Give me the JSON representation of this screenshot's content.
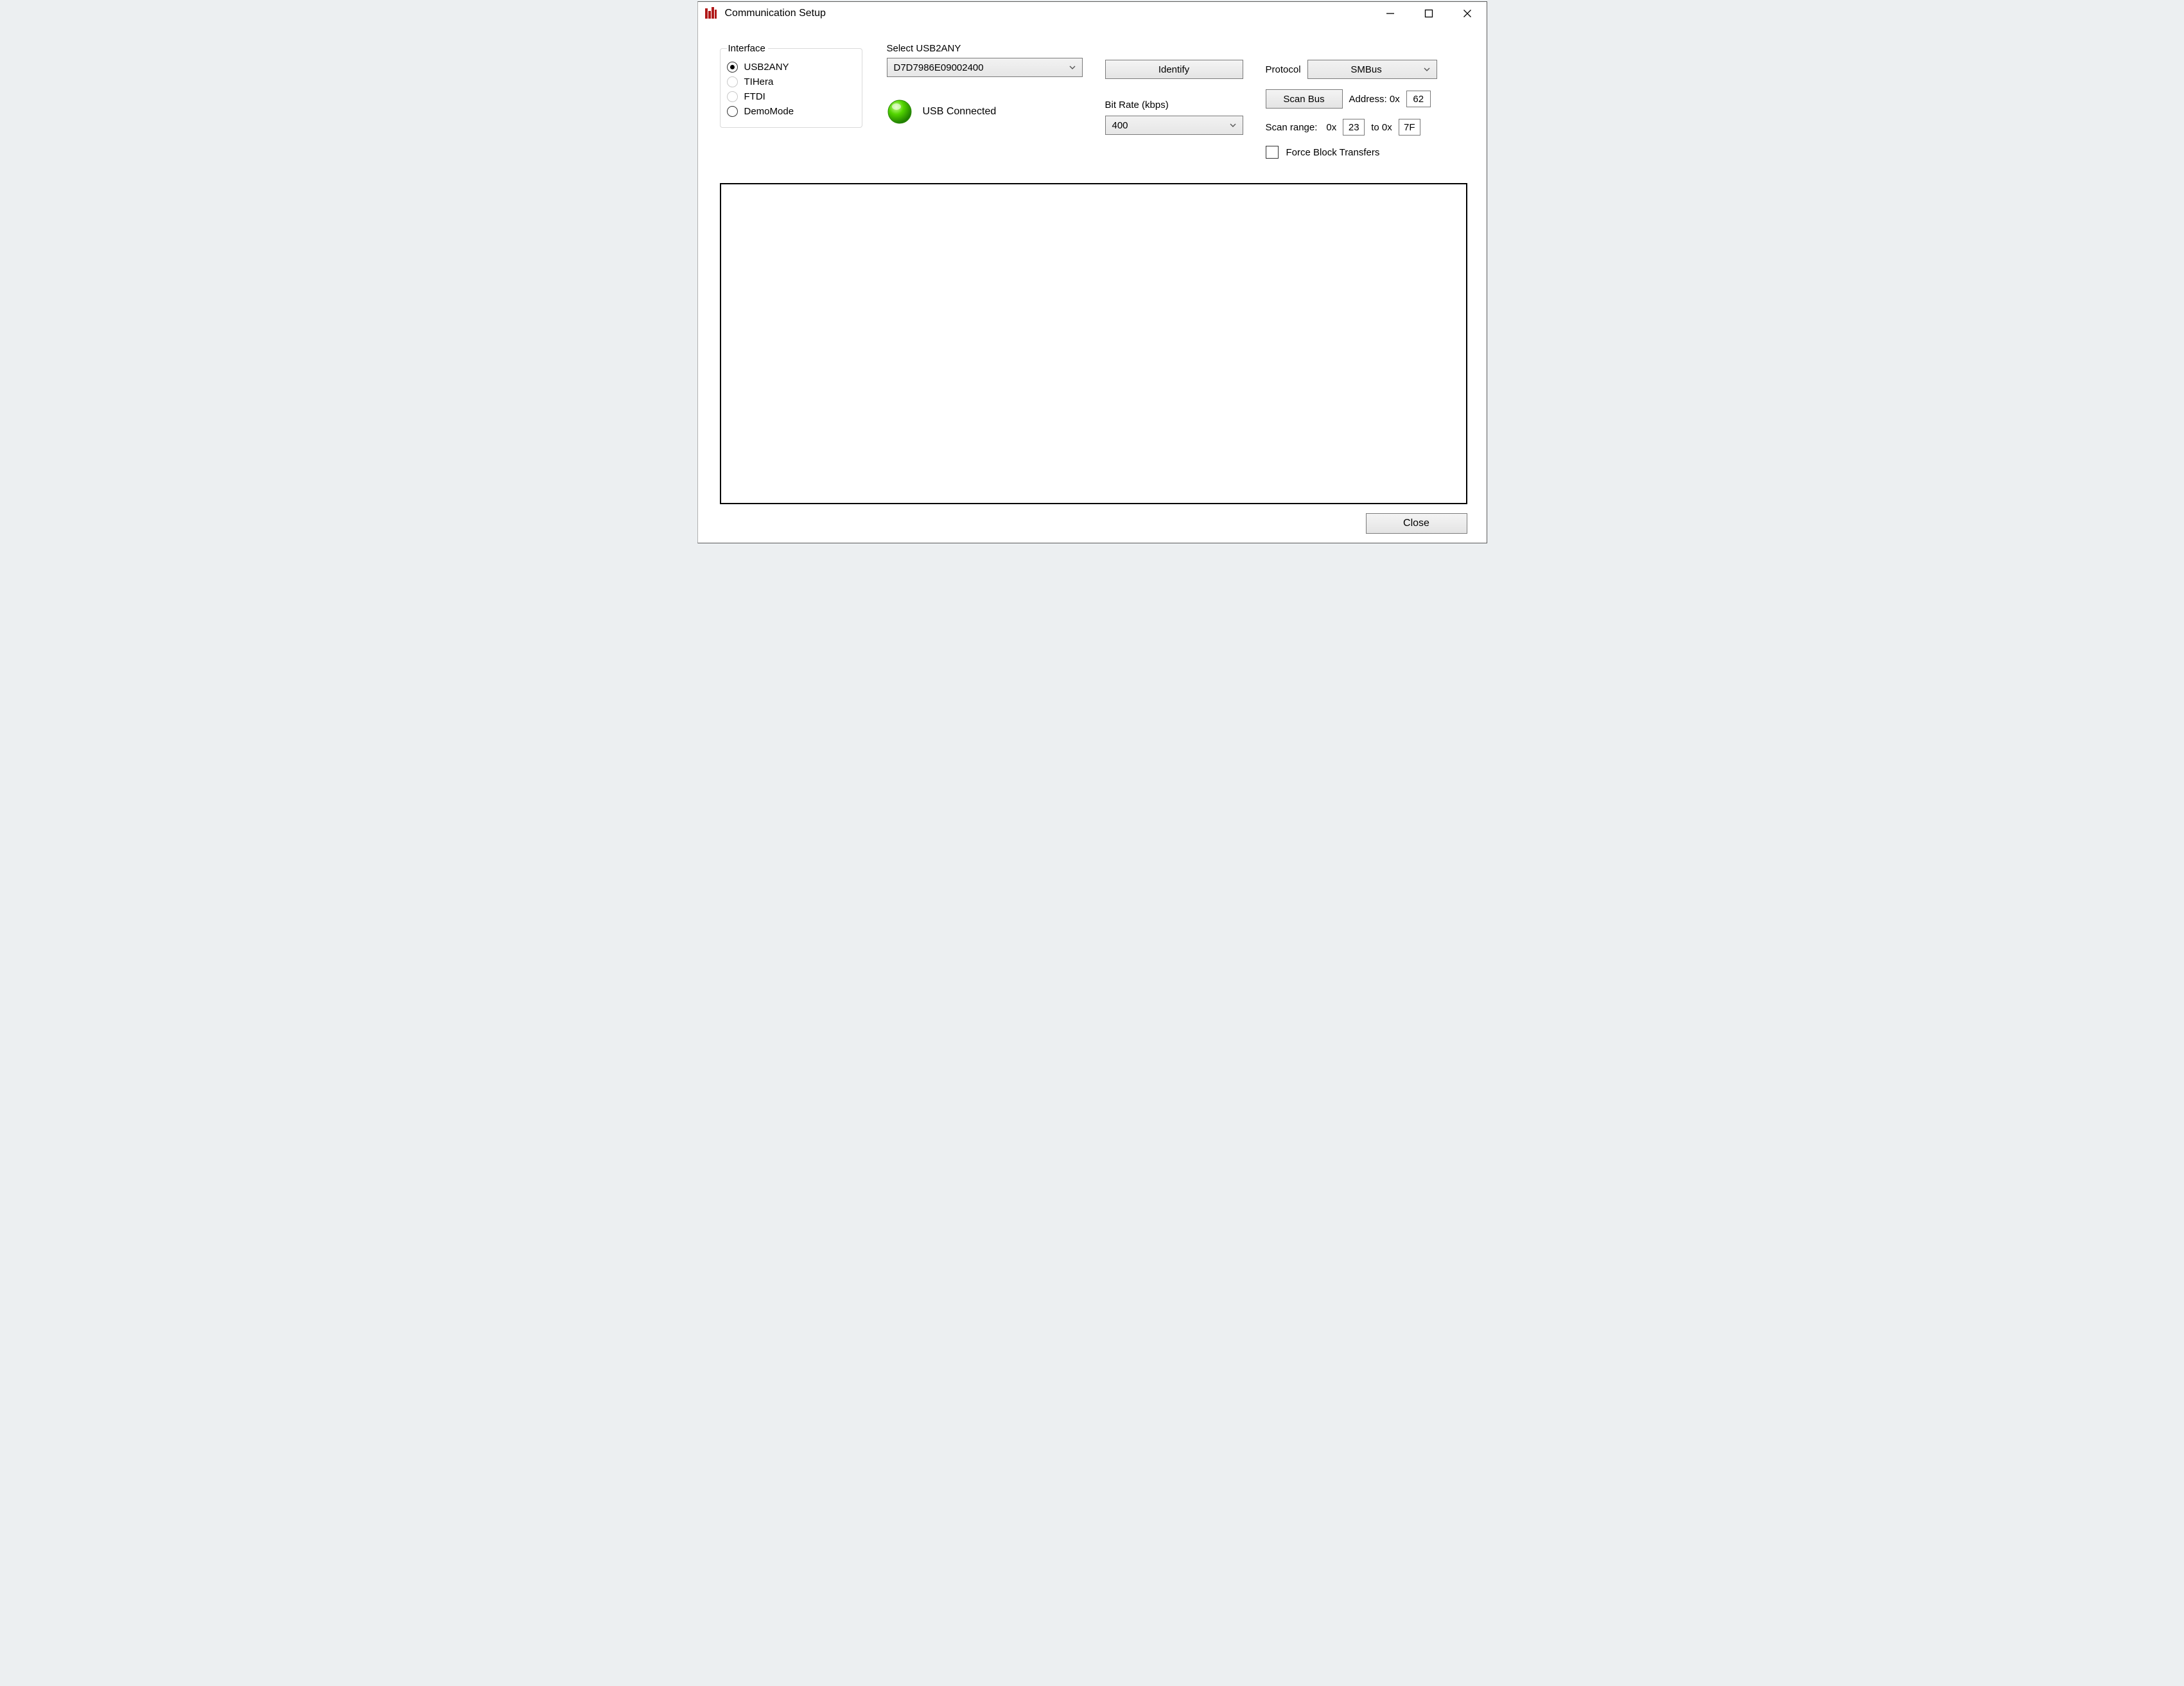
{
  "window": {
    "title": "Communication Setup"
  },
  "interface": {
    "legend": "Interface",
    "options": {
      "usb2any": "USB2ANY",
      "tihera": "TIHera",
      "ftdi": "FTDI",
      "demomode": "DemoMode"
    },
    "selected": "usb2any"
  },
  "usb2any_select": {
    "label": "Select USB2ANY",
    "value": "D7D7986E09002400"
  },
  "status": {
    "text": "USB Connected",
    "color": "#3fbf00"
  },
  "identify": {
    "label": "Identify"
  },
  "bitrate": {
    "label": "Bit Rate (kbps)",
    "value": "400"
  },
  "protocol": {
    "label": "Protocol",
    "value": "SMBus"
  },
  "scanbus": {
    "label": "Scan Bus"
  },
  "address": {
    "label": "Address: 0x",
    "value": "62"
  },
  "scanrange": {
    "label": "Scan range:",
    "from_prefix": "0x",
    "from": "23",
    "to_label": "to 0x",
    "to": "7F"
  },
  "force_block": {
    "label": "Force Block Transfers",
    "checked": false
  },
  "footer": {
    "close": "Close"
  }
}
